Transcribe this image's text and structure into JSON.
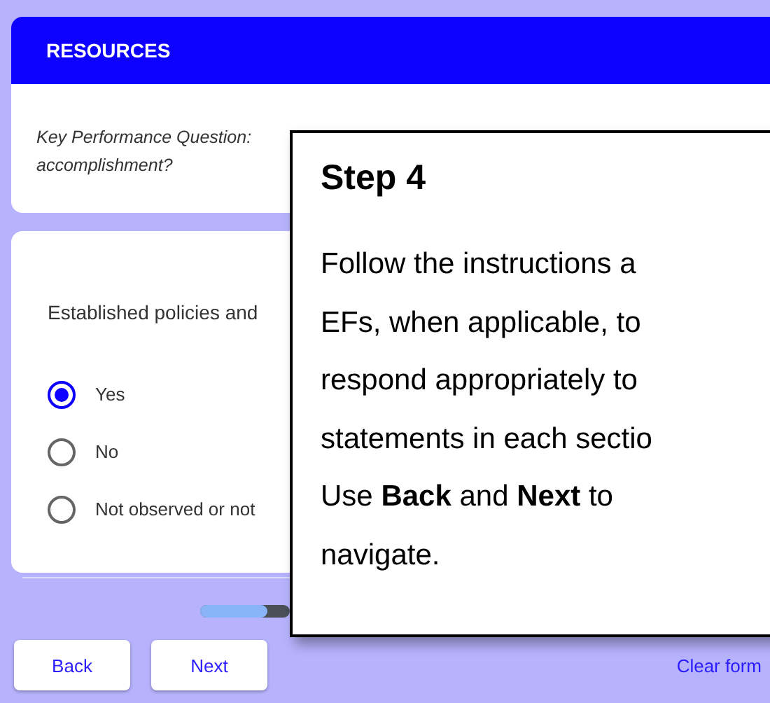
{
  "section_header": {
    "title": "RESOURCES"
  },
  "key_question": {
    "lines": [
      "Key Performance Question:",
      "accomplishment?"
    ]
  },
  "question": {
    "prompt": "Established policies and",
    "options": [
      {
        "label": "Yes",
        "selected": true
      },
      {
        "label": "No",
        "selected": false
      },
      {
        "label": "Not observed or not",
        "selected": false
      }
    ]
  },
  "progress": {
    "level": 0.75
  },
  "buttons": [
    {
      "label": "Back"
    },
    {
      "label": "Next"
    }
  ],
  "clear_link": "Clear form",
  "callout": {
    "title": "Step 4",
    "lines": [
      "Follow the instructions a",
      "EFs, when applicable, to",
      "respond appropriately to",
      "statements in each sectio",
      "Use **Back** and **Next** to",
      "navigate."
    ]
  }
}
